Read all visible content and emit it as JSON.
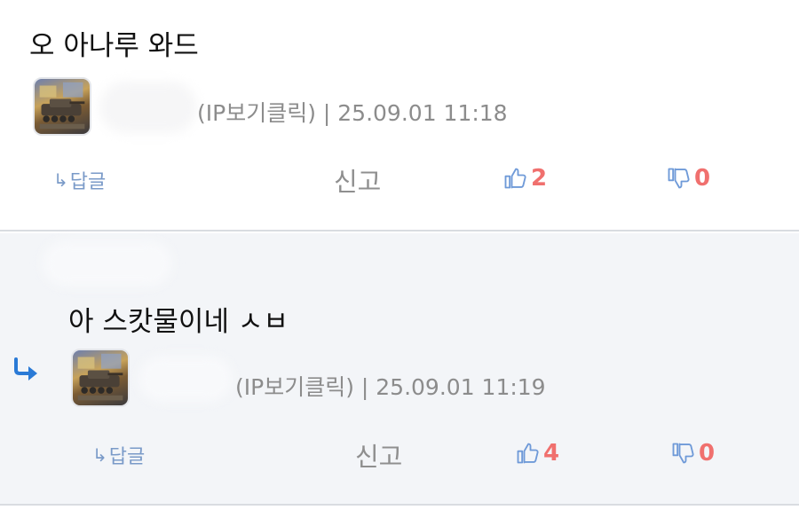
{
  "comments": [
    {
      "text": "오 아나루 와드",
      "meta": "(IP보기클릭) | 25.09.01 11:18",
      "reply_label": "답글",
      "report_label": "신고",
      "likes": "2",
      "dislikes": "0"
    },
    {
      "text": "아 스캇물이네 ㅅㅂ",
      "meta": "(IP보기클릭) | 25.09.01 11:19",
      "reply_label": "답글",
      "report_label": "신고",
      "likes": "4",
      "dislikes": "0"
    }
  ],
  "icons": {
    "thumb_up": "thumb-up-icon",
    "thumb_down": "thumb-down-icon",
    "reply_arrow": "reply-arrow-icon",
    "nested_reply": "nested-reply-icon"
  },
  "colors": {
    "accent_blue": "#6f9ad8",
    "vote_count": "#f0706e",
    "nested_arrow": "#2a7ad6",
    "reply_bg": "#f3f5f8"
  }
}
